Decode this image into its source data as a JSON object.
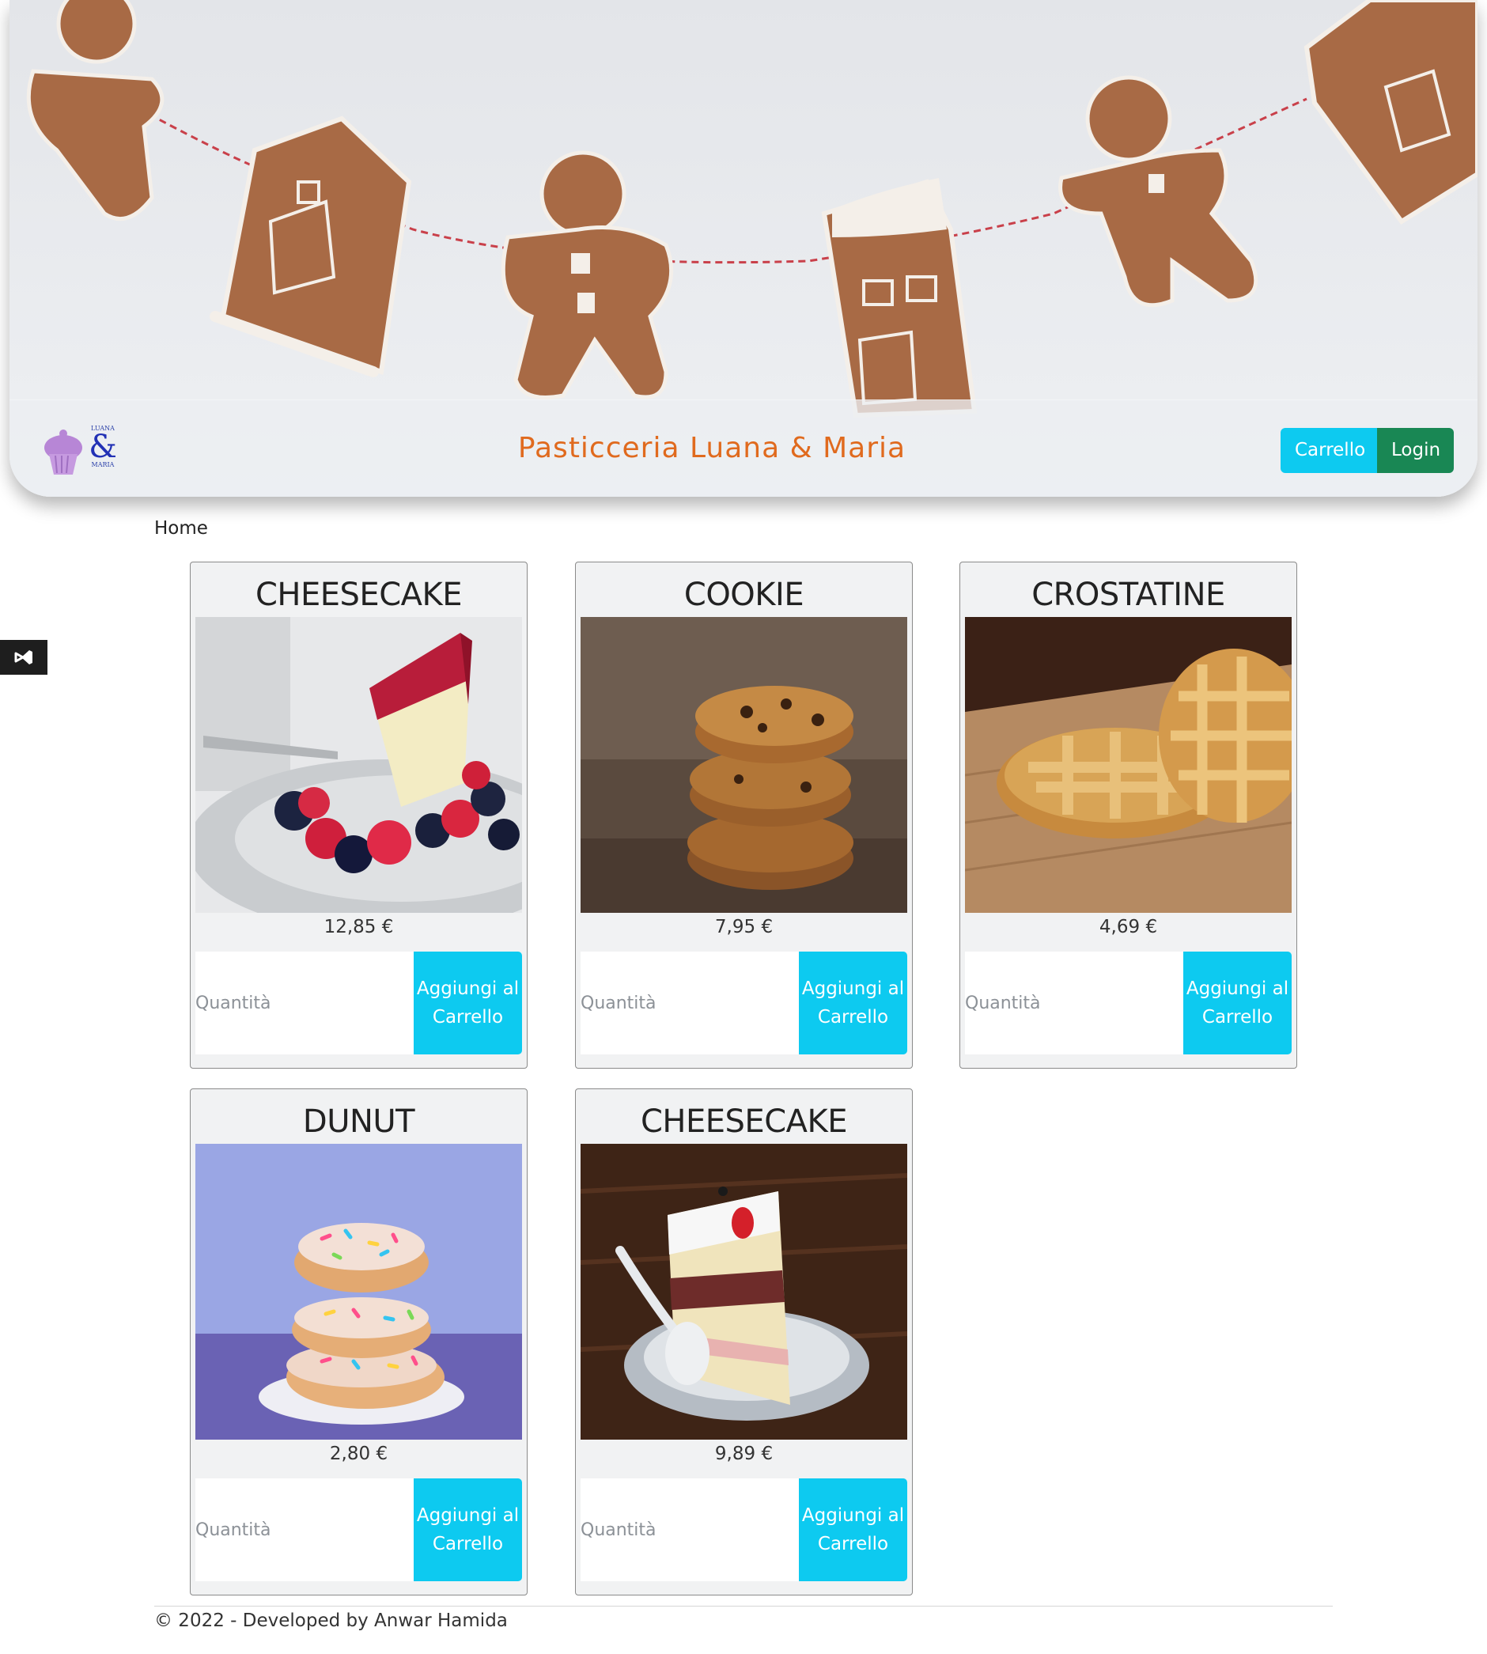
{
  "header": {
    "brand": "Pasticceria Luana & Maria",
    "logo_text_top": "LUANA",
    "logo_amp": "&",
    "logo_text_bottom": "MARIA",
    "cart_label": "Carrello",
    "login_label": "Login"
  },
  "breadcrumb": {
    "home": "Home"
  },
  "products": [
    {
      "name": "CHEESECAKE",
      "price": "12,85 €",
      "qty_placeholder": "Quantità",
      "button": "Aggiungi al Carrello"
    },
    {
      "name": "COOKIE",
      "price": "7,95 €",
      "qty_placeholder": "Quantità",
      "button": "Aggiungi al Carrello"
    },
    {
      "name": "CROSTATINE",
      "price": "4,69 €",
      "qty_placeholder": "Quantità",
      "button": "Aggiungi al Carrello"
    },
    {
      "name": "DUNUT",
      "price": "2,80 €",
      "qty_placeholder": "Quantità",
      "button": "Aggiungi al Carrello"
    },
    {
      "name": "CHEESECAKE",
      "price": "9,89 €",
      "qty_placeholder": "Quantità",
      "button": "Aggiungi al Carrello"
    }
  ],
  "footer": {
    "text": "© 2022 - Developed by Anwar Hamida"
  },
  "colors": {
    "brand": "#e06a1e",
    "info": "#0dcaf0",
    "success": "#198754",
    "card_bg": "#f1f2f3"
  }
}
